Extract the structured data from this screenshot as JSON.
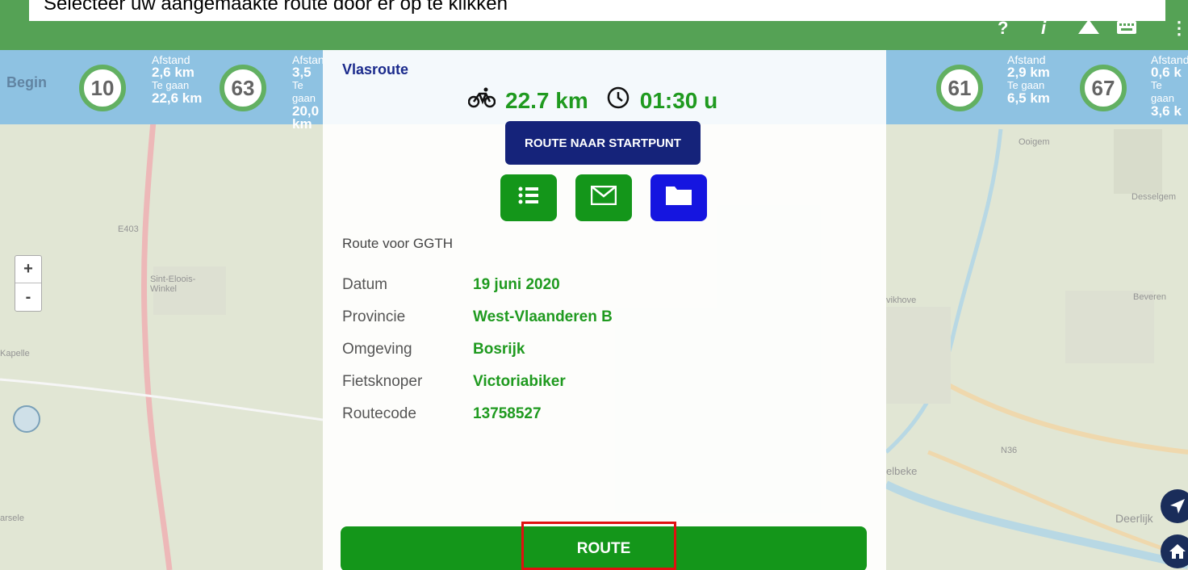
{
  "banner": {
    "text": "Selecteer uw aangemaakte route door er op te klikken"
  },
  "appbar": {
    "help": "?",
    "info": "i",
    "menu": "⋮"
  },
  "strip": {
    "begin": "Begin",
    "afstand_label": "Afstand",
    "tegaan_label": "Te gaan",
    "nodes": [
      {
        "num": "10",
        "dist": "2,6 km",
        "remain": "22,6 km"
      },
      {
        "num": "63",
        "dist": "3,5",
        "remain": "20,0 km"
      },
      {
        "num": "61",
        "dist": "2,9 km",
        "remain": "6,5 km"
      },
      {
        "num": "67",
        "dist": "0,6 k",
        "remain": "3,6 k"
      }
    ]
  },
  "map": {
    "labels": [
      "E403",
      "Sint-Eloois-Winkel",
      "Kapelle",
      "Ooigem",
      "Desselgem",
      "Beveren",
      "Deerlijk",
      "N36",
      "elbeke",
      "vikhove",
      "arsele"
    ]
  },
  "zoom": {
    "in": "+",
    "out": "-"
  },
  "dialog": {
    "title": "Vlasroute",
    "distance": "22.7 km",
    "duration": "01:30 u",
    "start_button": "ROUTE NAAR STARTPUNT",
    "subtitle": "Route voor GGTH",
    "rows": [
      {
        "label": "Datum",
        "value": "19 juni 2020"
      },
      {
        "label": "Provincie",
        "value": "West-Vlaanderen B"
      },
      {
        "label": "Omgeving",
        "value": "Bosrijk"
      },
      {
        "label": "Fietsknoper",
        "value": "Victoriabiker"
      },
      {
        "label": "Routecode",
        "value": "13758527"
      }
    ],
    "route_button": "ROUTE"
  },
  "colors": {
    "appbar": "#0c7a0c",
    "strip": "#5ea8d6",
    "green_text": "#1f9a1f",
    "navy": "#15237a",
    "folder_blue": "#1515e0",
    "highlight": "#e01010"
  }
}
